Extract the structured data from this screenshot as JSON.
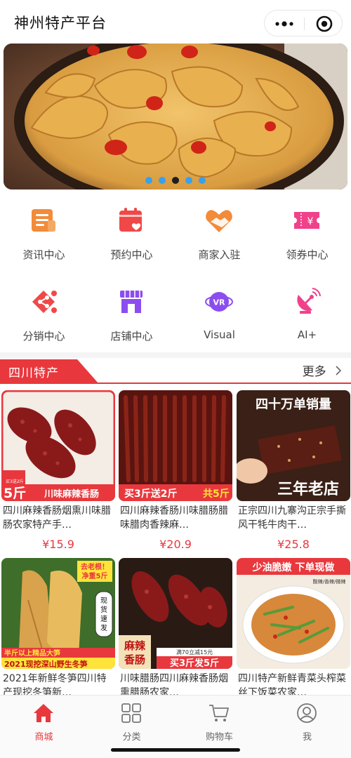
{
  "header": {
    "title": "神州特产平台",
    "more_icon": "ellipsis-icon",
    "close_icon": "target-icon"
  },
  "banner": {
    "dots": 5,
    "active_dot": 3
  },
  "grid": {
    "items": [
      {
        "label": "资讯中心",
        "icon": "news-icon",
        "color": "#f28b3a"
      },
      {
        "label": "预约中心",
        "icon": "calendar-heart-icon",
        "color": "#f04848"
      },
      {
        "label": "商家入驻",
        "icon": "handshake-heart-icon",
        "color": "#f28b3a"
      },
      {
        "label": "领券中心",
        "icon": "coupon-icon",
        "color": "#f0418b"
      },
      {
        "label": "分销中心",
        "icon": "share-nodes-icon",
        "color": "#f04848"
      },
      {
        "label": "店铺中心",
        "icon": "store-icon",
        "color": "#8c4df0"
      },
      {
        "label": "Visual",
        "icon": "vr-icon",
        "color": "#8c4df0"
      },
      {
        "label": "AI+",
        "icon": "satellite-dish-icon",
        "color": "#f0418b"
      }
    ]
  },
  "section": {
    "title": "四川特产",
    "more": "更多",
    "accent": "#e8383d"
  },
  "products": [
    {
      "name": "四川麻辣香肠烟熏川味腊肠农家特产手…",
      "price": "¥15.9",
      "badge_top": "买3送2斤",
      "badge_big": "5斤",
      "strip": "川味麻辣香肠"
    },
    {
      "name": "四川麻辣香肠川味腊肠腊味腊肉香辣麻…",
      "price": "¥20.9",
      "strip_left": "买3斤送2斤",
      "strip_right": "共5斤"
    },
    {
      "name": "正宗四川九寨沟正宗手撕风干牦牛肉干…",
      "price": "¥25.8",
      "top": "四十万单销量",
      "bottom": "三年老店"
    },
    {
      "name": "2021年新鲜冬笋四川特产现挖冬笋新…",
      "price": "",
      "tag1": "去老根！",
      "tag2": "净重5斤",
      "side": "现货速发",
      "line1": "半斤以上精品大笋",
      "line2": "2021现挖深山野生冬笋"
    },
    {
      "name": "川味腊肠四川麻辣香肠烟熏腊肠农家…",
      "price": "",
      "left": "麻辣香肠",
      "coupon": "满70立减15元",
      "strip": "买3斤发5斤"
    },
    {
      "name": "四川特产新鲜青菜头榨菜丝下饭菜农家…",
      "price": "",
      "top": "少油脆嫩 下单现做",
      "sub": "酸辣/香辣/微辣"
    }
  ],
  "tabbar": {
    "tabs": [
      {
        "label": "商城",
        "icon": "home-icon",
        "active": true
      },
      {
        "label": "分类",
        "icon": "grid-icon",
        "active": false
      },
      {
        "label": "购物车",
        "icon": "cart-icon",
        "active": false
      },
      {
        "label": "我",
        "icon": "user-icon",
        "active": false
      }
    ]
  }
}
